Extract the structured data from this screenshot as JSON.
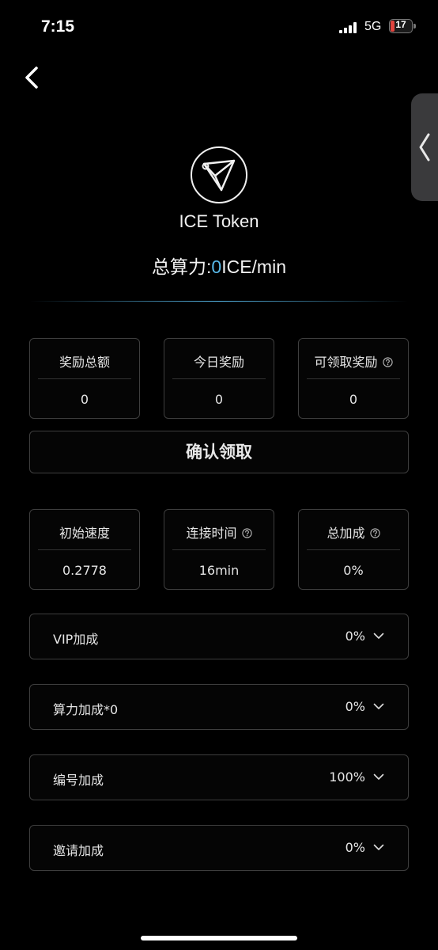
{
  "status_bar": {
    "time": "7:15",
    "network": "5G",
    "battery_level": "17",
    "battery_percent": 17
  },
  "header": {
    "token_name": "ICE Token",
    "hashrate_label": "总算力:",
    "hashrate_value": "0",
    "hashrate_unit": "ICE/min"
  },
  "rewards": [
    {
      "label": "奖励总额",
      "value": "0"
    },
    {
      "label": "今日奖励",
      "value": "0"
    },
    {
      "label": "可领取奖励",
      "value": "0"
    }
  ],
  "claim_button": {
    "label": "确认领取"
  },
  "speed_stats": [
    {
      "label": "初始速度",
      "value": "0.2778"
    },
    {
      "label": "连接时间",
      "value": "16min"
    },
    {
      "label": "总加成",
      "value": "0%"
    }
  ],
  "bonus_rows": [
    {
      "label": "VIP加成",
      "value": "0%"
    },
    {
      "label": "算力加成*0",
      "value": "0%"
    },
    {
      "label": "编号加成",
      "value": "100%"
    },
    {
      "label": "邀请加成",
      "value": "0%"
    }
  ],
  "colors": {
    "accent": "#58b8e8",
    "battery_low": "#e0443e",
    "card_border": "#3e3e3e"
  },
  "icons": {
    "back": "chevron-left-icon",
    "side_handle": "chevron-left-icon",
    "logo": "paper-plane-icon",
    "help": "question-circle-icon",
    "expand": "chevron-down-icon"
  }
}
